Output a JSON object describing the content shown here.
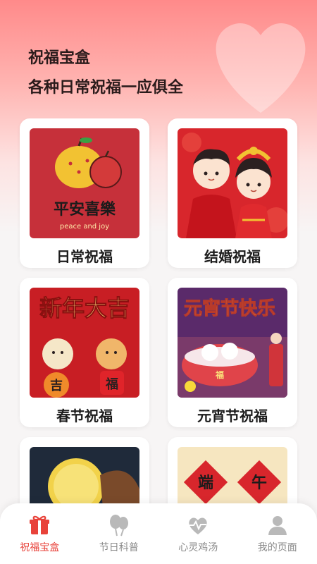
{
  "header": {
    "title": "祝福宝盒",
    "subtitle": "各种日常祝福一应俱全"
  },
  "cards": [
    {
      "label": "日常祝福",
      "thumb_text": "平安喜樂",
      "thumb_subtext": "peace and joy"
    },
    {
      "label": "结婚祝福"
    },
    {
      "label": "春节祝福",
      "thumb_text": "新年大吉",
      "thumb_chars": [
        "吉",
        "福"
      ]
    },
    {
      "label": "元宵节祝福",
      "thumb_text": "元宵节快乐",
      "thumb_chars": [
        "福"
      ]
    },
    {
      "label": ""
    },
    {
      "label": "",
      "thumb_chars": [
        "端",
        "午"
      ]
    }
  ],
  "tabbar": {
    "items": [
      {
        "label": "祝福宝盒",
        "icon": "gift-icon",
        "active": true
      },
      {
        "label": "节日科普",
        "icon": "balloon-icon",
        "active": false
      },
      {
        "label": "心灵鸡汤",
        "icon": "heartbeat-icon",
        "active": false
      },
      {
        "label": "我的页面",
        "icon": "user-icon",
        "active": false
      }
    ]
  },
  "colors": {
    "accent": "#e8423a",
    "inactive": "#8a8a8a",
    "hero_top": "#ff8a8a"
  }
}
